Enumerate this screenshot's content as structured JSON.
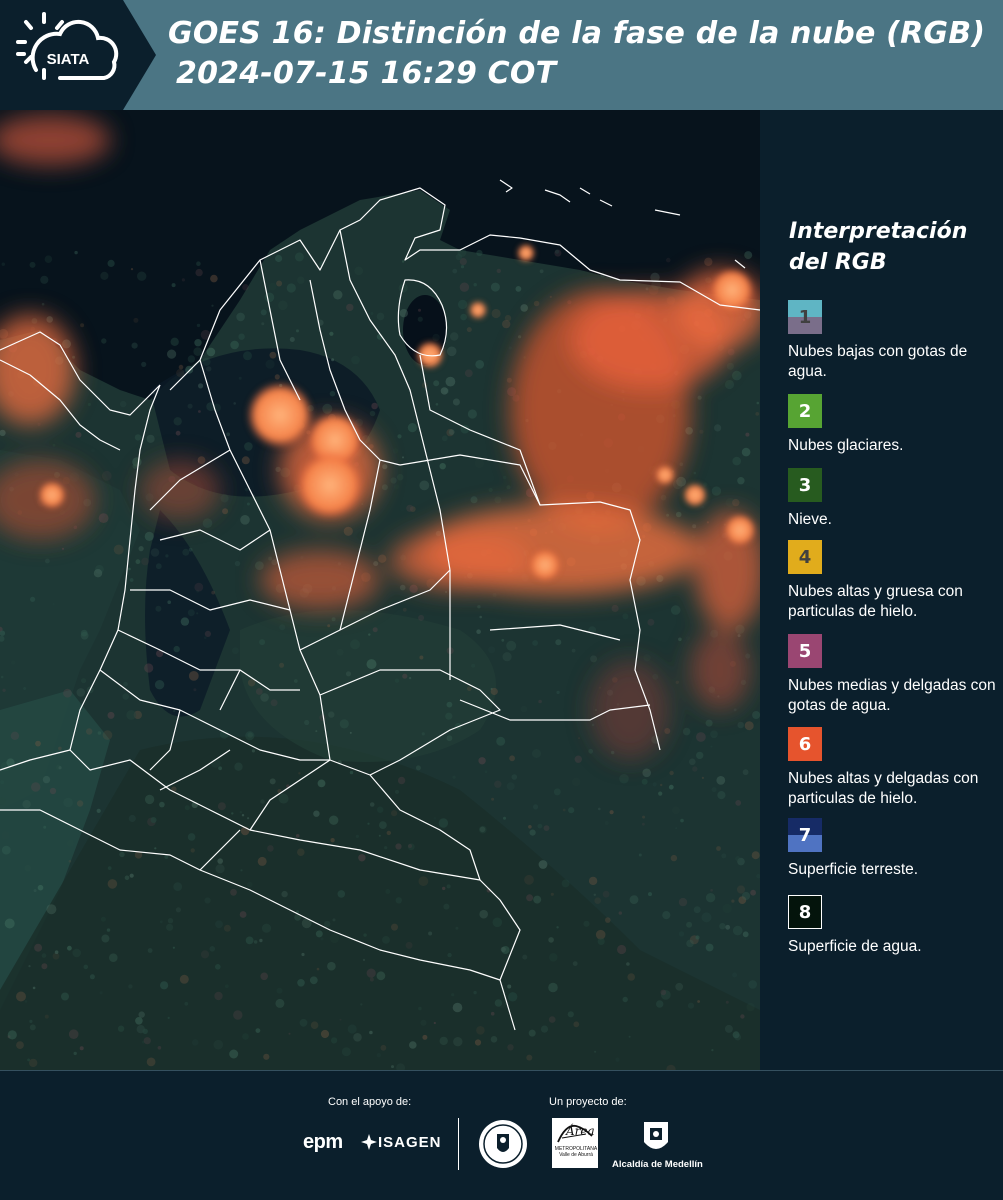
{
  "header": {
    "logo_text": "SIATA",
    "title_line1": "GOES 16: Distinción de la fase de la nube (RGB)",
    "title_line2": "2024-07-15 16:29 COT",
    "background_color": "#4b7584"
  },
  "legend": {
    "title": "Interpretación del RGB",
    "items": [
      {
        "number": "1",
        "text": "Nubes bajas con gotas de agua.",
        "colors": [
          "#5fb5c4",
          "#7a6e8a"
        ],
        "number_color": "#404040"
      },
      {
        "number": "2",
        "text": "Nubes glaciares.",
        "colors": [
          "#57a433"
        ],
        "number_color": "#ffffff"
      },
      {
        "number": "3",
        "text": "Nieve.",
        "colors": [
          "#275b1f"
        ],
        "number_color": "#ffffff"
      },
      {
        "number": "4",
        "text": "Nubes altas y gruesa con particulas de hielo.",
        "colors": [
          "#e1ac1c"
        ],
        "number_color": "#404040"
      },
      {
        "number": "5",
        "text": "Nubes medias y delgadas con gotas de agua.",
        "colors": [
          "#9a4672"
        ],
        "number_color": "#ffffff"
      },
      {
        "number": "6",
        "text": "Nubes altas y delgadas con particulas de hielo.",
        "colors": [
          "#e6542d"
        ],
        "number_color": "#ffffff"
      },
      {
        "number": "7",
        "text": "Superficie terreste.",
        "colors": [
          "#162b66",
          "#4f73c2"
        ],
        "number_color": "#ffffff"
      },
      {
        "number": "8",
        "text": "Superficie de agua.",
        "colors": [
          "#04140c"
        ],
        "number_color": "#ffffff",
        "border": "#ffffff"
      }
    ]
  },
  "footer": {
    "support_label": "Con el apoyo de:",
    "project_label": "Un proyecto de:",
    "epm": "epm",
    "isagen": "ISAGEN",
    "amva_title": "Área",
    "amva_sub": "METROPOLITANA Valle de Aburrá",
    "medellin": "Alcaldía de Medellín"
  },
  "map": {
    "land_color": "#1f3a36",
    "water_color": "#07131c",
    "warm_cloud_color": "#f26a3c",
    "bright_cloud_color": "#ff9a5a",
    "border_color": "#ffffff"
  }
}
